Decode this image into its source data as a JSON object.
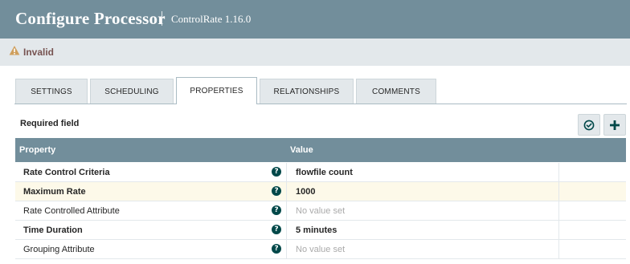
{
  "header": {
    "title": "Configure Processor",
    "subtitle": "ControlRate 1.16.0"
  },
  "status": {
    "text": "Invalid",
    "icon": "warning-icon",
    "color": "#cf9f5d"
  },
  "tabs": [
    {
      "label": "SETTINGS",
      "active": false
    },
    {
      "label": "SCHEDULING",
      "active": false
    },
    {
      "label": "PROPERTIES",
      "active": true
    },
    {
      "label": "RELATIONSHIPS",
      "active": false
    },
    {
      "label": "COMMENTS",
      "active": false
    }
  ],
  "properties_panel": {
    "required_label": "Required field",
    "buttons": [
      {
        "icon": "verify-icon"
      },
      {
        "icon": "plus-icon"
      }
    ],
    "columns": {
      "property": "Property",
      "value": "Value"
    },
    "rows": [
      {
        "name": "Rate Control Criteria",
        "required": true,
        "value": "flowfile count",
        "highlighted": false
      },
      {
        "name": "Maximum Rate",
        "required": true,
        "value": "1000",
        "highlighted": true
      },
      {
        "name": "Rate Controlled Attribute",
        "required": false,
        "value": "No value set",
        "highlighted": false
      },
      {
        "name": "Time Duration",
        "required": true,
        "value": "5 minutes",
        "highlighted": false
      },
      {
        "name": "Grouping Attribute",
        "required": false,
        "value": "No value set",
        "highlighted": false
      }
    ],
    "help_glyph": "?"
  },
  "colors": {
    "header_bg": "#728e9b",
    "status_bg": "#e3e8eb",
    "highlight_row": "#fdf9e9",
    "help_icon": "#004849"
  }
}
